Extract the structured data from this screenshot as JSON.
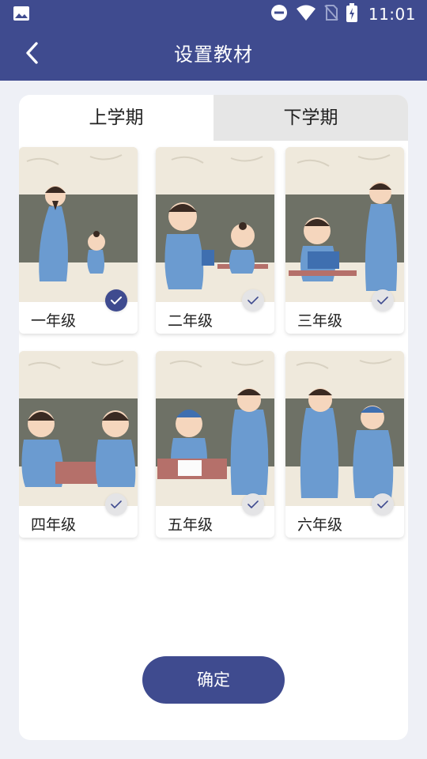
{
  "status_bar": {
    "time": "11:01"
  },
  "app_bar": {
    "title": "设置教材"
  },
  "tabs": [
    {
      "label": "上学期",
      "active": true
    },
    {
      "label": "下学期",
      "active": false
    }
  ],
  "grades": [
    {
      "label": "一年级",
      "selected": true
    },
    {
      "label": "二年级",
      "selected": false
    },
    {
      "label": "三年级",
      "selected": false
    },
    {
      "label": "四年级",
      "selected": false
    },
    {
      "label": "五年级",
      "selected": false
    },
    {
      "label": "六年级",
      "selected": false
    }
  ],
  "confirm_button": {
    "label": "确定"
  },
  "colors": {
    "primary": "#3f4b8f",
    "page_bg": "#eef0f6",
    "robe": "#6b9bd0",
    "wall": "#6e7166"
  }
}
